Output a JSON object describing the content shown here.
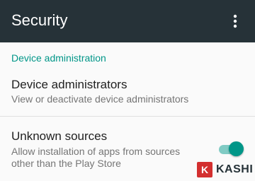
{
  "app_bar": {
    "title": "Security",
    "overflow_icon": "more-vert-icon",
    "background_color": "#263238"
  },
  "sections": [
    {
      "header": "Device administration",
      "accent_color": "#009688"
    }
  ],
  "preferences": [
    {
      "title": "Device administrators",
      "summary": "View or deactivate device administrators"
    },
    {
      "title": "Unknown sources",
      "summary_line1": "Allow installation of apps from sources",
      "summary_line2": "other than the Play Store",
      "toggle_state": "on"
    }
  ],
  "watermark": {
    "logo_letter": "K",
    "text": "KASHI",
    "logo_color": "#d32f2f"
  }
}
